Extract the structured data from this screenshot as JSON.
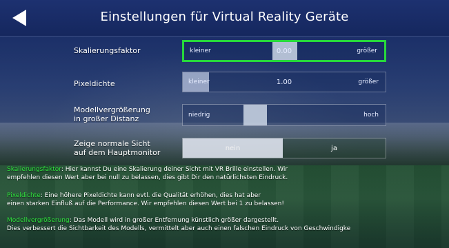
{
  "header": {
    "title": "Einstellungen für Virtual Reality Geräte"
  },
  "settings": {
    "scale": {
      "label": "Skalierungsfaktor",
      "min_label": "kleiner",
      "max_label": "größer",
      "value": "0.00"
    },
    "pixel": {
      "label": "Pixeldichte",
      "min_label": "kleiner",
      "max_label": "größer",
      "value": "1.00"
    },
    "model": {
      "label_line1": "Modellvergrößerung",
      "label_line2": "in großer Distanz",
      "min_label": "niedrig",
      "max_label": "hoch",
      "level": 0.35
    },
    "monitor": {
      "label_line1": "Zeige normale Sicht",
      "label_line2": "auf dem Hauptmonitor",
      "off_label": "nein",
      "on_label": "ja",
      "selected": "nein"
    }
  },
  "help": {
    "scale": {
      "term": "Skalierungsfaktor",
      "line1": ": Hier kannst Du eine Skalierung deiner Sicht mit VR Brille einstellen. Wir",
      "line2": "empfehlen diesen Wert aber bei null zu belassen, dies gibt Dir den natürlichsten Eindruck."
    },
    "pixel": {
      "term": "Pixeldichte",
      "line1": ": Eine höhere Pixeldichte kann evtl. die Qualität erhöhen, dies hat aber",
      "line2": "einen starken Einfluß auf die Performance. Wir empfehlen diesen Wert bei 1 zu belassen!"
    },
    "model": {
      "term": "Modellvergrößerung",
      "line1": ": Das Modell wird in großer Entfernung künstlich größer dargestellt.",
      "line2": "Dies verbessert die Sichtbarkeit des Modells, vermittelt aber auch einen falschen Eindruck von Geschwindigke"
    }
  },
  "colors": {
    "accent": "#27d83c",
    "header": "#1d3170"
  }
}
